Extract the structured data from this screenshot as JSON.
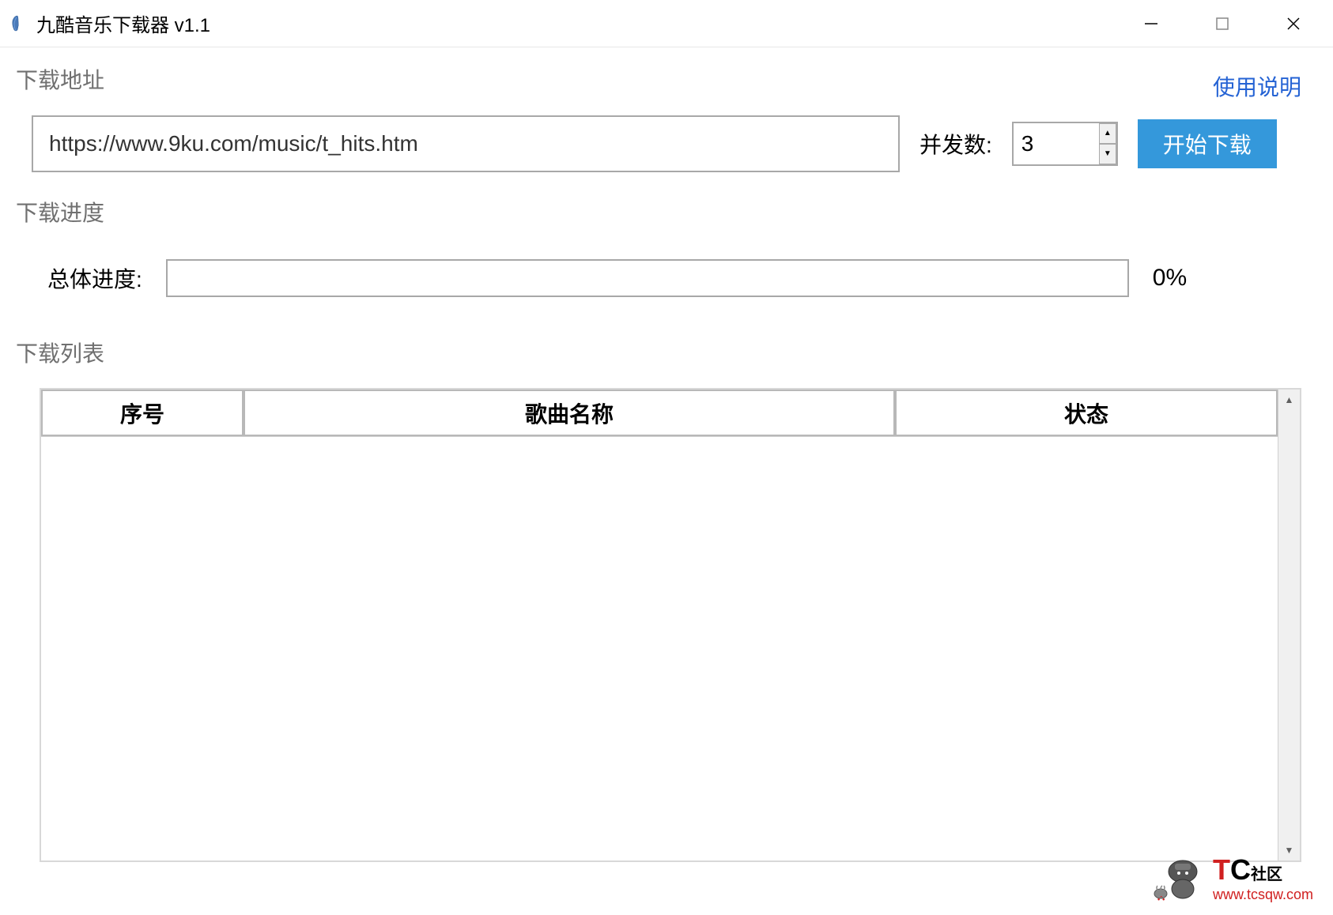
{
  "window": {
    "title": "九酷音乐下载器 v1.1"
  },
  "address": {
    "section_label": "下载地址",
    "help_link": "使用说明",
    "url_value": "https://www.9ku.com/music/t_hits.htm",
    "concurrent_label": "并发数:",
    "concurrent_value": "3",
    "start_button": "开始下载"
  },
  "progress": {
    "section_label": "下载进度",
    "overall_label": "总体进度:",
    "percent": "0%"
  },
  "list": {
    "section_label": "下载列表",
    "columns": {
      "index": "序号",
      "name": "歌曲名称",
      "status": "状态"
    }
  },
  "watermark": {
    "brand_t": "T",
    "brand_c": "C",
    "community": "社区",
    "url": "www.tcsqw.com"
  }
}
